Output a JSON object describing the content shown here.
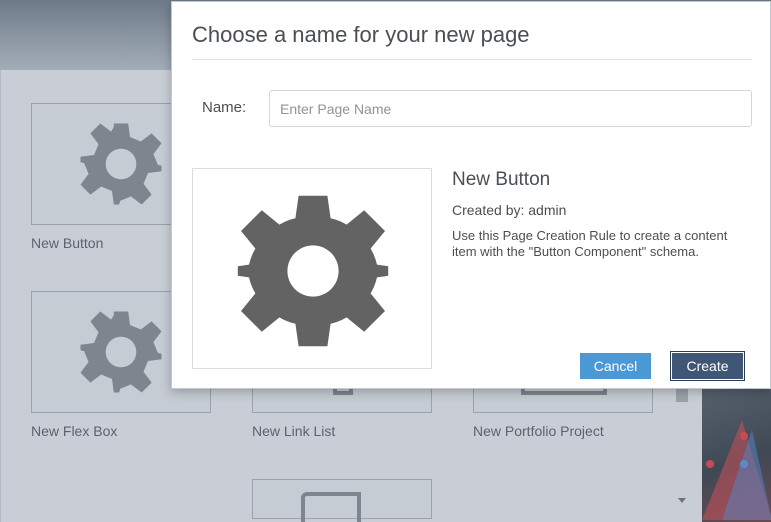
{
  "background": {
    "tiles": [
      {
        "label": "New Button"
      },
      {
        "label": "New Flex Box"
      },
      {
        "label": "New Link List"
      },
      {
        "label": "New Portfolio Project"
      }
    ]
  },
  "modal": {
    "title": "Choose a name for your new page",
    "name_label": "Name:",
    "name_value": "",
    "name_placeholder": "Enter Page Name",
    "selected_template": {
      "title": "New Button",
      "created_by": "Created by: admin",
      "description": "Use this Page Creation Rule to create a content item with the \"Button Component\" schema.",
      "icon": "gear-icon"
    },
    "cancel_label": "Cancel",
    "create_label": "Create"
  },
  "colors": {
    "cancel_button": "#4a98d6",
    "create_button": "#3f5775",
    "gear": "#636363"
  }
}
